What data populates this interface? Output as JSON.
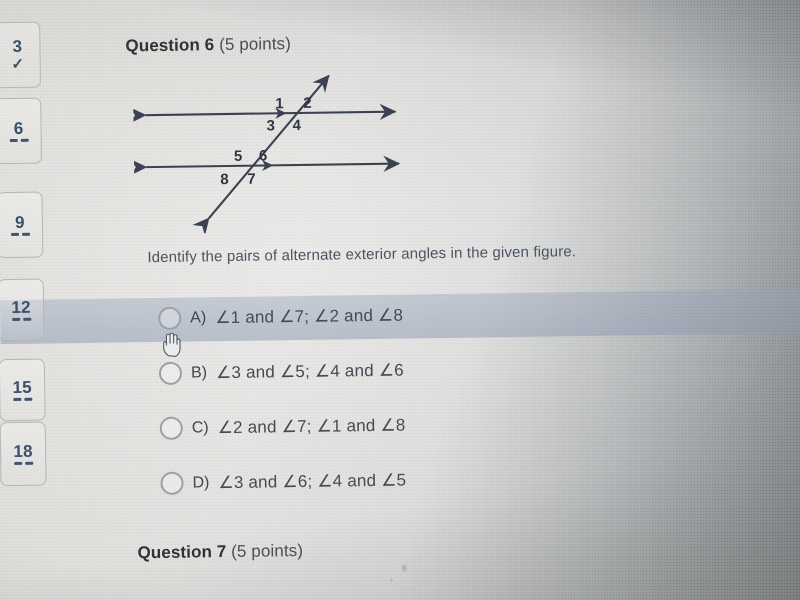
{
  "sidebar": {
    "cards": [
      {
        "number": "3",
        "status_icon": "check-icon",
        "status": "answered"
      },
      {
        "number": "6",
        "status_icon": "dash-icon",
        "status": "unanswered"
      },
      {
        "number": "9",
        "status_icon": "dash-icon",
        "status": "unanswered"
      },
      {
        "number": "12",
        "status_icon": "dash-icon",
        "status": "unanswered"
      },
      {
        "number": "15",
        "status_icon": "dash-icon",
        "status": "unanswered"
      },
      {
        "number": "18",
        "status_icon": "dash-icon",
        "status": "unanswered"
      }
    ],
    "check_glyph": "✓"
  },
  "question": {
    "heading_label": "Question 6",
    "heading_points": "(5 points)",
    "prompt": "Identify the pairs of alternate exterior angles in the given figure."
  },
  "figure": {
    "name": "parallel-lines-transversal-diagram",
    "angle_labels": [
      "1",
      "2",
      "3",
      "4",
      "5",
      "6",
      "7",
      "8"
    ],
    "line_color": "#3a4150"
  },
  "options": [
    {
      "letter": "A)",
      "text": "∠1 and ∠7; ∠2 and ∠8",
      "selected": false,
      "highlighted": true
    },
    {
      "letter": "B)",
      "text": "∠3 and ∠5; ∠4 and ∠6",
      "selected": false,
      "highlighted": false
    },
    {
      "letter": "C)",
      "text": "∠2 and ∠7; ∠1 and ∠8",
      "selected": false,
      "highlighted": false
    },
    {
      "letter": "D)",
      "text": "∠3 and ∠6; ∠4 and ∠5",
      "selected": false,
      "highlighted": false
    }
  ],
  "next_question": {
    "heading_label": "Question 7",
    "heading_points": "(5 points)"
  },
  "cursor": {
    "type": "pointing-hand-cursor"
  },
  "colors": {
    "accent": "#3c4f6b",
    "text": "#434b54",
    "heading": "#2f3337",
    "highlight_band": "#8d9ab2",
    "figure_line": "#3a4150"
  }
}
